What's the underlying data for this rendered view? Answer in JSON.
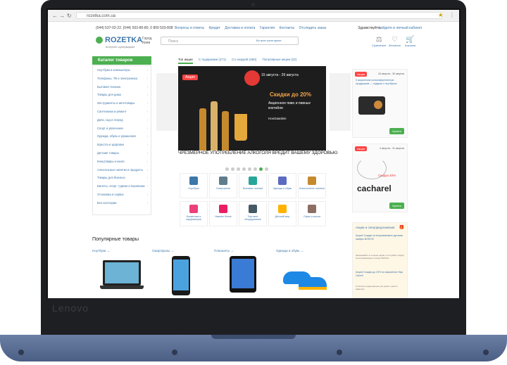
{
  "device": {
    "brand": "Lenovo"
  },
  "browser": {
    "url": "rozetka.com.ua"
  },
  "header": {
    "phones": "(044) 537-02-22, (044) 503-80-80, 0 800 503-808",
    "links": [
      "Вопросы и ответы",
      "Кредит",
      "Доставка и оплата",
      "Гарантия",
      "Контакты",
      "Отследить заказ"
    ],
    "greeting": "Здравствуйте,",
    "login": "войдите в личный кабинет",
    "brand": "ROZETKA",
    "tagline": "интернет-супермаркет",
    "city_label": "Город",
    "city": "Киев",
    "search_placeholder": "Поиск",
    "categories_select": "Во всех категориях",
    "icons": [
      {
        "name": "compare-icon",
        "label": "Сравнение"
      },
      {
        "name": "heart-icon",
        "label": "Желания"
      },
      {
        "name": "cart-icon",
        "label": "Корзина"
      }
    ]
  },
  "catalog": {
    "button": "Каталог товаров",
    "items": [
      "Ноутбуки и компьютеры",
      "Телефоны, ТВ и электроника",
      "Бытовая техника",
      "Товары для дома",
      "Инструменты и автотовары",
      "Сантехника и ремонт",
      "Дача, сад и огород",
      "Спорт и увлечения",
      "Одежда, обувь и украшения",
      "Красота и здоровье",
      "Детские товары",
      "Канцтовары и книги",
      "Алкогольные напитки и продукты",
      "Товары для бизнеса",
      "Билеты, спорт, туризм и перевозки",
      "Установка и сервис",
      "Все категории"
    ]
  },
  "tabs": [
    "Топ акции",
    "С подарками (271)",
    "Со скидкой (360)",
    "Популярные акции (22)"
  ],
  "banner": {
    "badge": "Акция",
    "date": "15 августа - 29 августа",
    "headline": "Скидки до 20%",
    "sub": "Акционное пиво и пивные коктейли",
    "shop": "HoxGaarden",
    "slogan": "ЧРЕЗМЕРНОЕ УПОТРЕБЛЕНИЕ АЛКОГОЛЯ ВРЕДИТ ВАШЕМУ ЗДОРОВЬЮ"
  },
  "tiles": [
    {
      "label": "Ноутбуки",
      "color": "#3e77aa"
    },
    {
      "label": "Смартфоны",
      "color": "#607d8b"
    },
    {
      "label": "Бытовая техника",
      "color": "#26a69a"
    },
    {
      "label": "Одежда и обувь",
      "color": "#5c6bc0"
    },
    {
      "label": "Алкогольные напитки",
      "color": "#c68a2e"
    },
    {
      "label": "Косметика и парфюмерия",
      "color": "#ec407a"
    },
    {
      "label": "Нижнее белье",
      "color": "#e91e63"
    },
    {
      "label": "Торговое оборудование",
      "color": "#455a64"
    },
    {
      "label": "Детский мир",
      "color": "#ffb300"
    },
    {
      "label": "Офис и школа",
      "color": "#8d6e63"
    }
  ],
  "offers": [
    {
      "tag": "Акция",
      "date": "16 августа - 30 августа",
      "text": "К акционным консьюмерелятным продукциям — подарки с ноутбуком",
      "buy": "Купить"
    },
    {
      "tag": "Акция",
      "date": "4 августа - 31 августа",
      "text": "Скидка 40%",
      "brand": "cacharel",
      "buy": "Купить"
    }
  ],
  "popular": {
    "title": "Популярные товары",
    "cats": [
      "Ноутбуки →",
      "Смартфоны →",
      "Планшеты →",
      "Одежда и обувь →"
    ]
  },
  "promo": {
    "header": "Акции и спецпредложения",
    "item1": "Акция! Скидки на встраиваемые духовые шкафы BOSCH!",
    "desc1": "Заказывайте в течение акции и получайте скидку на встраиваемую технику BOSCH",
    "item2": "Акция! Скидка до 20% на акционные бры Calvell",
    "desc2": "Отличное предложение для дома и уюта в квартире"
  }
}
